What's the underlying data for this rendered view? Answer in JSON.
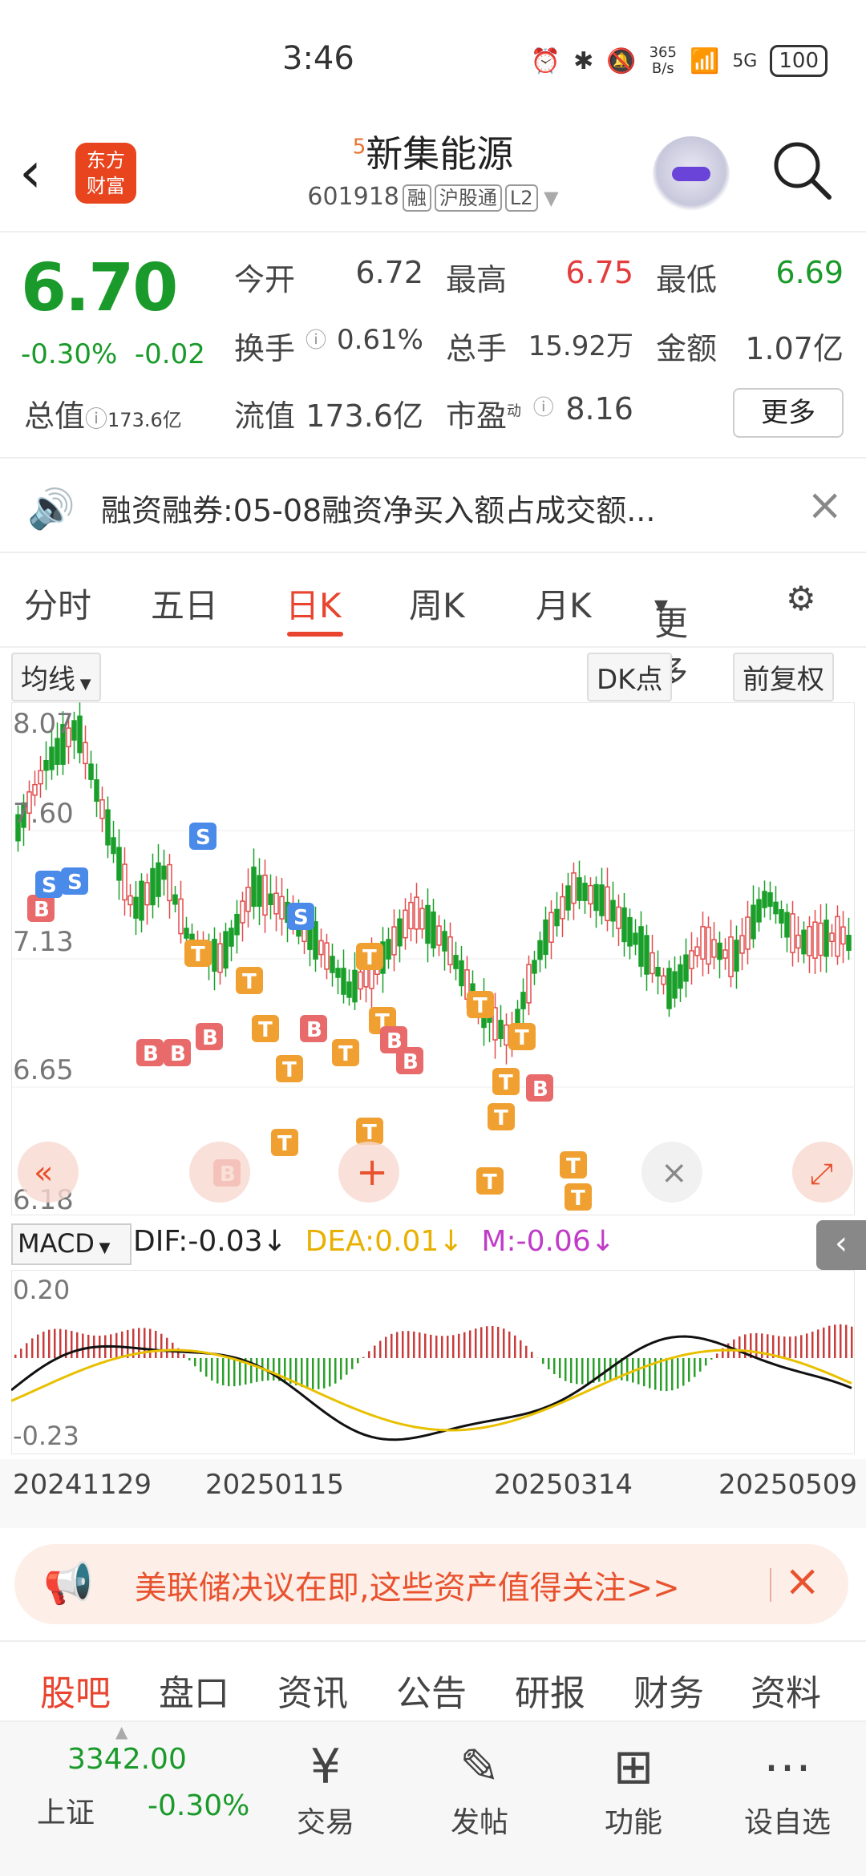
{
  "status": {
    "time": "3:46",
    "speed_top": "365",
    "speed_bottom": "B/s",
    "net": "5G",
    "battery": "100"
  },
  "header": {
    "app_logo": "东方\n财富",
    "superscript": "5",
    "title": "新集能源",
    "code": "601918",
    "tags": [
      "融",
      "沪股通",
      "L2"
    ]
  },
  "quote": {
    "price": "6.70",
    "change_pct": "-0.30%",
    "change": "-0.02",
    "zz_label": "总值",
    "zz_value": "173.6亿",
    "open_label": "今开",
    "open": "6.72",
    "high_label": "最高",
    "high": "6.75",
    "low_label": "最低",
    "low": "6.69",
    "turnover_label": "换手",
    "turnover": "0.61%",
    "volume_label": "总手",
    "volume": "15.92万",
    "amount_label": "金额",
    "amount": "1.07亿",
    "float_label": "流值",
    "float": "173.6亿",
    "pe_label": "市盈",
    "pe_sup": "动",
    "pe": "8.16",
    "more": "更多"
  },
  "notice": {
    "text": "融资融券:05-08融资净买入额占成交额..."
  },
  "tabs": [
    "分时",
    "五日",
    "日K",
    "周K",
    "月K",
    "更多"
  ],
  "chart_controls": {
    "ma": "均线",
    "dk": "DK点",
    "adjust": "前复权"
  },
  "chart_data": {
    "type": "candlestick",
    "yticks": [
      "8.07",
      "7.60",
      "7.13",
      "6.65",
      "6.18"
    ],
    "ylim": [
      6.18,
      8.07
    ],
    "xticks": [
      "20241129",
      "20250115",
      "20250314",
      "20250509"
    ]
  },
  "macd": {
    "selector": "MACD",
    "dif": "DIF:-0.03↓",
    "dea": "DEA:0.01↓",
    "m": "M:-0.06↓",
    "ytop": "0.20",
    "ybottom": "-0.23"
  },
  "promo": {
    "text": "美联储决议在即,这些资产值得关注>>"
  },
  "subtabs": [
    "股吧",
    "盘口",
    "资讯",
    "公告",
    "研报",
    "财务",
    "资料"
  ],
  "bottom": {
    "index_value": "3342.00",
    "index_name": "上证",
    "index_pct": "-0.30%",
    "nav": [
      "交易",
      "发帖",
      "功能",
      "设自选"
    ]
  }
}
